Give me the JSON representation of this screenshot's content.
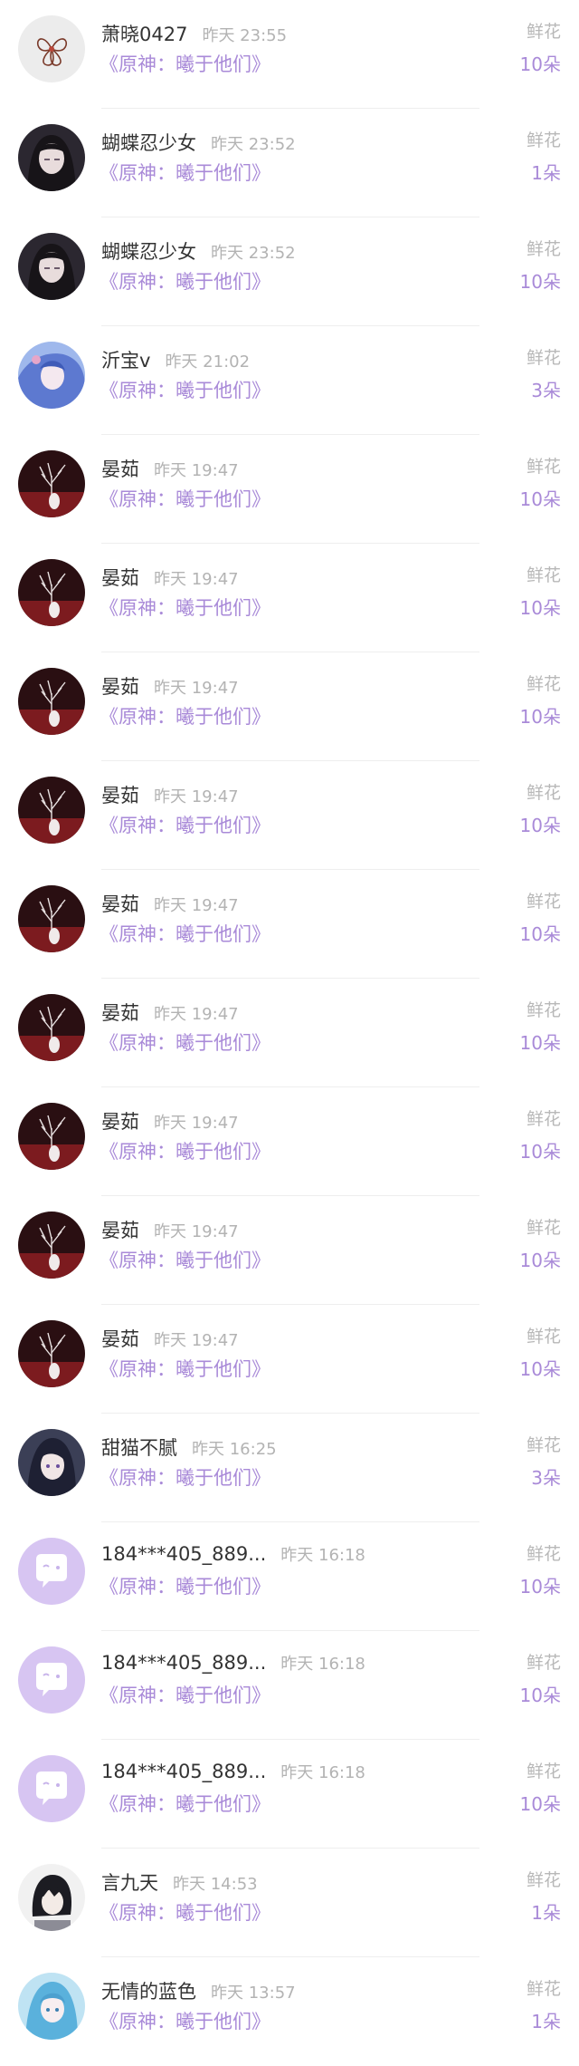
{
  "colors": {
    "accent": "#a98ad8",
    "name_text": "#333333",
    "muted_text": "#b3b3b3",
    "default_avatar_bg": "#d7c5f2"
  },
  "rows": [
    {
      "avatar": "flower-sketch-avatar",
      "name": "萧晓0427",
      "time": "昨天 23:55",
      "book": "《原神：曦于他们》",
      "gift_label": "鲜花",
      "gift_count": "10朵"
    },
    {
      "avatar": "anime-girl-dark-avatar",
      "name": "蝴蝶忍少女",
      "time": "昨天 23:52",
      "book": "《原神：曦于他们》",
      "gift_label": "鲜花",
      "gift_count": "1朵"
    },
    {
      "avatar": "anime-girl-dark-avatar",
      "name": "蝴蝶忍少女",
      "time": "昨天 23:52",
      "book": "《原神：曦于他们》",
      "gift_label": "鲜花",
      "gift_count": "10朵"
    },
    {
      "avatar": "blue-anime-girl-avatar",
      "name": "沂宝v",
      "time": "昨天 21:02",
      "book": "《原神：曦于他们》",
      "gift_label": "鲜花",
      "gift_count": "3朵"
    },
    {
      "avatar": "red-tree-art-avatar",
      "name": "晏茹",
      "time": "昨天 19:47",
      "book": "《原神：曦于他们》",
      "gift_label": "鲜花",
      "gift_count": "10朵"
    },
    {
      "avatar": "red-tree-art-avatar",
      "name": "晏茹",
      "time": "昨天 19:47",
      "book": "《原神：曦于他们》",
      "gift_label": "鲜花",
      "gift_count": "10朵"
    },
    {
      "avatar": "red-tree-art-avatar",
      "name": "晏茹",
      "time": "昨天 19:47",
      "book": "《原神：曦于他们》",
      "gift_label": "鲜花",
      "gift_count": "10朵"
    },
    {
      "avatar": "red-tree-art-avatar",
      "name": "晏茹",
      "time": "昨天 19:47",
      "book": "《原神：曦于他们》",
      "gift_label": "鲜花",
      "gift_count": "10朵"
    },
    {
      "avatar": "red-tree-art-avatar",
      "name": "晏茹",
      "time": "昨天 19:47",
      "book": "《原神：曦于他们》",
      "gift_label": "鲜花",
      "gift_count": "10朵"
    },
    {
      "avatar": "red-tree-art-avatar",
      "name": "晏茹",
      "time": "昨天 19:47",
      "book": "《原神：曦于他们》",
      "gift_label": "鲜花",
      "gift_count": "10朵"
    },
    {
      "avatar": "red-tree-art-avatar",
      "name": "晏茹",
      "time": "昨天 19:47",
      "book": "《原神：曦于他们》",
      "gift_label": "鲜花",
      "gift_count": "10朵"
    },
    {
      "avatar": "red-tree-art-avatar",
      "name": "晏茹",
      "time": "昨天 19:47",
      "book": "《原神：曦于他们》",
      "gift_label": "鲜花",
      "gift_count": "10朵"
    },
    {
      "avatar": "red-tree-art-avatar",
      "name": "晏茹",
      "time": "昨天 19:47",
      "book": "《原神：曦于他们》",
      "gift_label": "鲜花",
      "gift_count": "10朵"
    },
    {
      "avatar": "dark-hair-girl-avatar",
      "name": "甜猫不腻",
      "time": "昨天 16:25",
      "book": "《原神：曦于他们》",
      "gift_label": "鲜花",
      "gift_count": "3朵"
    },
    {
      "avatar": "default-chat-bubble-avatar",
      "name": "184***405_889...",
      "time": "昨天 16:18",
      "book": "《原神：曦于他们》",
      "gift_label": "鲜花",
      "gift_count": "10朵"
    },
    {
      "avatar": "default-chat-bubble-avatar",
      "name": "184***405_889...",
      "time": "昨天 16:18",
      "book": "《原神：曦于他们》",
      "gift_label": "鲜花",
      "gift_count": "10朵"
    },
    {
      "avatar": "default-chat-bubble-avatar",
      "name": "184***405_889...",
      "time": "昨天 16:18",
      "book": "《原神：曦于他们》",
      "gift_label": "鲜花",
      "gift_count": "10朵"
    },
    {
      "avatar": "anime-boy-avatar",
      "name": "言九天",
      "time": "昨天 14:53",
      "book": "《原神：曦于他们》",
      "gift_label": "鲜花",
      "gift_count": "1朵"
    },
    {
      "avatar": "blue-hair-girl-avatar",
      "name": "无情的蓝色",
      "time": "昨天 13:57",
      "book": "《原神：曦于他们》",
      "gift_label": "鲜花",
      "gift_count": "1朵"
    }
  ]
}
